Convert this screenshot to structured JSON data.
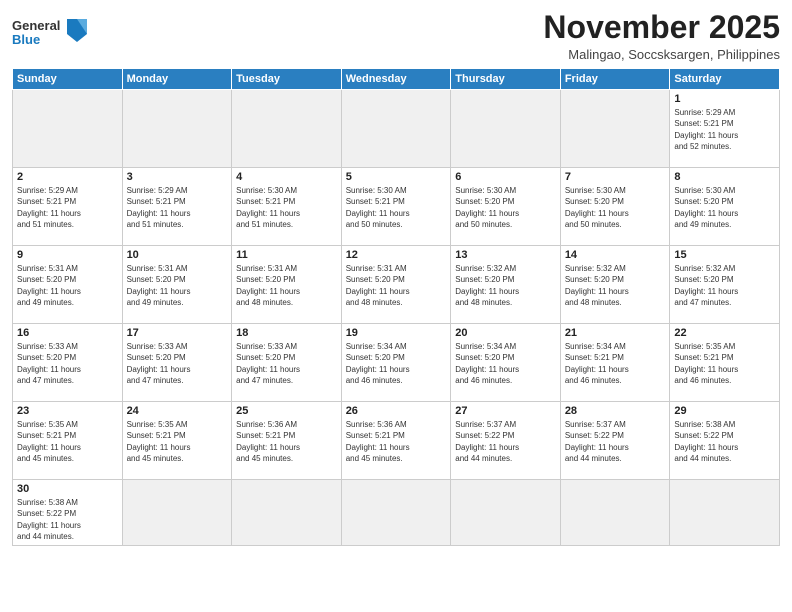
{
  "header": {
    "logo_general": "General",
    "logo_blue": "Blue",
    "title": "November 2025",
    "location": "Malingao, Soccsksargen, Philippines"
  },
  "days_of_week": [
    "Sunday",
    "Monday",
    "Tuesday",
    "Wednesday",
    "Thursday",
    "Friday",
    "Saturday"
  ],
  "weeks": [
    [
      {
        "day": "",
        "info": "",
        "empty": true
      },
      {
        "day": "",
        "info": "",
        "empty": true
      },
      {
        "day": "",
        "info": "",
        "empty": true
      },
      {
        "day": "",
        "info": "",
        "empty": true
      },
      {
        "day": "",
        "info": "",
        "empty": true
      },
      {
        "day": "",
        "info": "",
        "empty": true
      },
      {
        "day": "1",
        "info": "Sunrise: 5:29 AM\nSunset: 5:21 PM\nDaylight: 11 hours\nand 52 minutes."
      }
    ],
    [
      {
        "day": "2",
        "info": "Sunrise: 5:29 AM\nSunset: 5:21 PM\nDaylight: 11 hours\nand 51 minutes."
      },
      {
        "day": "3",
        "info": "Sunrise: 5:29 AM\nSunset: 5:21 PM\nDaylight: 11 hours\nand 51 minutes."
      },
      {
        "day": "4",
        "info": "Sunrise: 5:30 AM\nSunset: 5:21 PM\nDaylight: 11 hours\nand 51 minutes."
      },
      {
        "day": "5",
        "info": "Sunrise: 5:30 AM\nSunset: 5:21 PM\nDaylight: 11 hours\nand 50 minutes."
      },
      {
        "day": "6",
        "info": "Sunrise: 5:30 AM\nSunset: 5:20 PM\nDaylight: 11 hours\nand 50 minutes."
      },
      {
        "day": "7",
        "info": "Sunrise: 5:30 AM\nSunset: 5:20 PM\nDaylight: 11 hours\nand 50 minutes."
      },
      {
        "day": "8",
        "info": "Sunrise: 5:30 AM\nSunset: 5:20 PM\nDaylight: 11 hours\nand 49 minutes."
      }
    ],
    [
      {
        "day": "9",
        "info": "Sunrise: 5:31 AM\nSunset: 5:20 PM\nDaylight: 11 hours\nand 49 minutes."
      },
      {
        "day": "10",
        "info": "Sunrise: 5:31 AM\nSunset: 5:20 PM\nDaylight: 11 hours\nand 49 minutes."
      },
      {
        "day": "11",
        "info": "Sunrise: 5:31 AM\nSunset: 5:20 PM\nDaylight: 11 hours\nand 48 minutes."
      },
      {
        "day": "12",
        "info": "Sunrise: 5:31 AM\nSunset: 5:20 PM\nDaylight: 11 hours\nand 48 minutes."
      },
      {
        "day": "13",
        "info": "Sunrise: 5:32 AM\nSunset: 5:20 PM\nDaylight: 11 hours\nand 48 minutes."
      },
      {
        "day": "14",
        "info": "Sunrise: 5:32 AM\nSunset: 5:20 PM\nDaylight: 11 hours\nand 48 minutes."
      },
      {
        "day": "15",
        "info": "Sunrise: 5:32 AM\nSunset: 5:20 PM\nDaylight: 11 hours\nand 47 minutes."
      }
    ],
    [
      {
        "day": "16",
        "info": "Sunrise: 5:33 AM\nSunset: 5:20 PM\nDaylight: 11 hours\nand 47 minutes."
      },
      {
        "day": "17",
        "info": "Sunrise: 5:33 AM\nSunset: 5:20 PM\nDaylight: 11 hours\nand 47 minutes."
      },
      {
        "day": "18",
        "info": "Sunrise: 5:33 AM\nSunset: 5:20 PM\nDaylight: 11 hours\nand 47 minutes."
      },
      {
        "day": "19",
        "info": "Sunrise: 5:34 AM\nSunset: 5:20 PM\nDaylight: 11 hours\nand 46 minutes."
      },
      {
        "day": "20",
        "info": "Sunrise: 5:34 AM\nSunset: 5:20 PM\nDaylight: 11 hours\nand 46 minutes."
      },
      {
        "day": "21",
        "info": "Sunrise: 5:34 AM\nSunset: 5:21 PM\nDaylight: 11 hours\nand 46 minutes."
      },
      {
        "day": "22",
        "info": "Sunrise: 5:35 AM\nSunset: 5:21 PM\nDaylight: 11 hours\nand 46 minutes."
      }
    ],
    [
      {
        "day": "23",
        "info": "Sunrise: 5:35 AM\nSunset: 5:21 PM\nDaylight: 11 hours\nand 45 minutes."
      },
      {
        "day": "24",
        "info": "Sunrise: 5:35 AM\nSunset: 5:21 PM\nDaylight: 11 hours\nand 45 minutes."
      },
      {
        "day": "25",
        "info": "Sunrise: 5:36 AM\nSunset: 5:21 PM\nDaylight: 11 hours\nand 45 minutes."
      },
      {
        "day": "26",
        "info": "Sunrise: 5:36 AM\nSunset: 5:21 PM\nDaylight: 11 hours\nand 45 minutes."
      },
      {
        "day": "27",
        "info": "Sunrise: 5:37 AM\nSunset: 5:22 PM\nDaylight: 11 hours\nand 44 minutes."
      },
      {
        "day": "28",
        "info": "Sunrise: 5:37 AM\nSunset: 5:22 PM\nDaylight: 11 hours\nand 44 minutes."
      },
      {
        "day": "29",
        "info": "Sunrise: 5:38 AM\nSunset: 5:22 PM\nDaylight: 11 hours\nand 44 minutes."
      }
    ],
    [
      {
        "day": "30",
        "info": "Sunrise: 5:38 AM\nSunset: 5:22 PM\nDaylight: 11 hours\nand 44 minutes.",
        "last": true
      },
      {
        "day": "",
        "info": "",
        "empty": true,
        "last": true
      },
      {
        "day": "",
        "info": "",
        "empty": true,
        "last": true
      },
      {
        "day": "",
        "info": "",
        "empty": true,
        "last": true
      },
      {
        "day": "",
        "info": "",
        "empty": true,
        "last": true
      },
      {
        "day": "",
        "info": "",
        "empty": true,
        "last": true
      },
      {
        "day": "",
        "info": "",
        "empty": true,
        "last": true
      }
    ]
  ]
}
